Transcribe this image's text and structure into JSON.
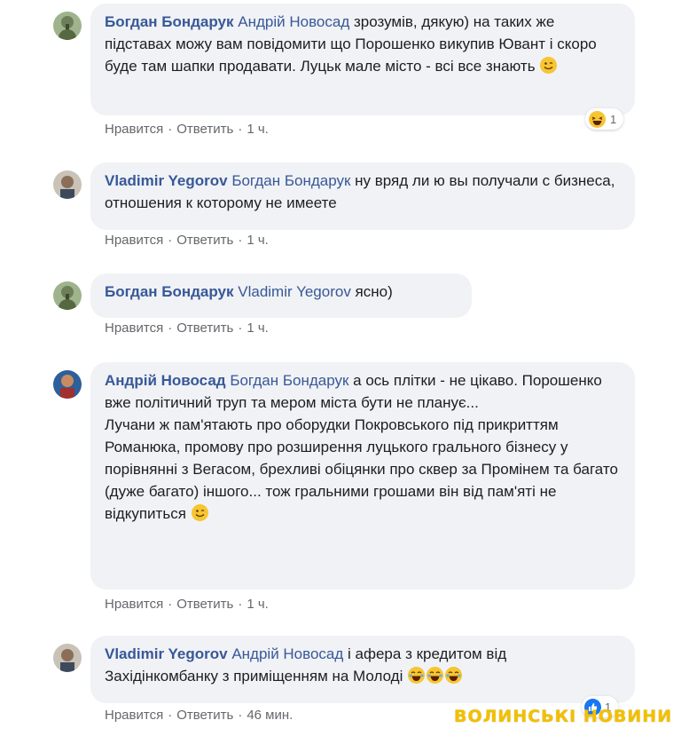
{
  "comments": [
    {
      "author": "Богдан Бондарук",
      "mention": "Андрій Новосад",
      "text": " зрозумів, дякую) на таких же підставах можу вам повідомити що Порошенко викупив Ювант і скоро буде там шапки продавати. Луцьк мале місто - всі все знають ",
      "emoji": "wink-emoji",
      "actions": {
        "like": "Нравится",
        "reply": "Ответить",
        "time": "1 ч."
      },
      "reaction": {
        "icon": "laugh-reaction-icon",
        "count": "1"
      }
    },
    {
      "author": "Vladimir Yegorov",
      "mention": "Богдан Бондарук",
      "text": " ну вряд ли ю вы получали с бизнеса, отношения к которому не имеете",
      "actions": {
        "like": "Нравится",
        "reply": "Ответить",
        "time": "1 ч."
      }
    },
    {
      "author": "Богдан Бондарук",
      "mention": "Vladimir Yegorov",
      "text": " ясно)",
      "actions": {
        "like": "Нравится",
        "reply": "Ответить",
        "time": "1 ч."
      }
    },
    {
      "author": "Андрій Новосад",
      "mention": "Богдан Бондарук",
      "text1": " а ось плітки - не цікаво. Порошенко вже політичний труп та мером міста бути не планує...",
      "text2": "Лучани ж пам'ятають про оборудки Покровського під прикриттям Романюка, промову про розширення луцького грального бізнесу у порівнянні з Вегасом, брехливі обіцянки про сквер за Промінем та багато (дуже багато) іншого... тож гральними грошами він від пам'яті не відкупиться ",
      "emoji": "wink-emoji",
      "actions": {
        "like": "Нравится",
        "reply": "Ответить",
        "time": "1 ч."
      }
    },
    {
      "author": "Vladimir Yegorov",
      "mention": "Андрій Новосад",
      "text": " і афера з кредитом від Західінкомбанку з приміщенням на Молоді ",
      "emoji": "laughing-emoji",
      "actions": {
        "like": "Нравится",
        "reply": "Ответить",
        "time": "46 мин."
      },
      "reaction": {
        "icon": "like-reaction-icon",
        "count": "1"
      }
    }
  ],
  "separator": "·",
  "watermark": "ВОЛИНСЬКІ НОВИНИ",
  "colors": {
    "link": "#385898",
    "bubble": "#f0f2f5",
    "meta": "#65676b",
    "watermark": "#f2c000"
  }
}
